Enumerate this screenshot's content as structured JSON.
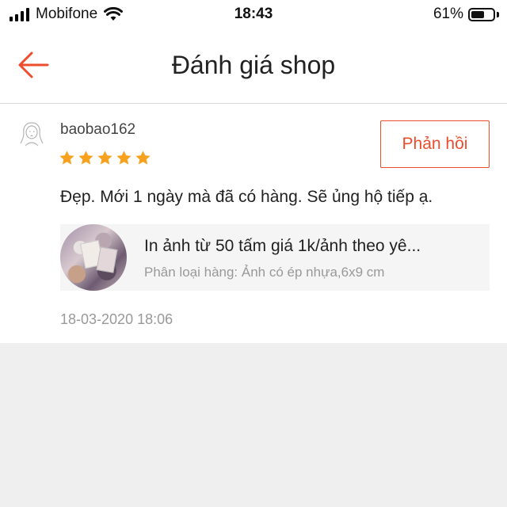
{
  "status_bar": {
    "carrier": "Mobifone",
    "time": "18:43",
    "battery_percent": "61%",
    "battery_level": 0.61
  },
  "nav": {
    "title": "Đánh giá shop"
  },
  "review": {
    "username": "baobao162",
    "rating": 5,
    "reply_label": "Phản hồi",
    "comment": "Đẹp. Mới 1 ngày mà đã có hàng. Sẽ ủng hộ tiếp ạ.",
    "product": {
      "name": "In ảnh từ 50 tấm giá 1k/ảnh theo yê...",
      "variation": "Phân loại hàng: Ảnh có ép nhựa,6x9 cm"
    },
    "timestamp": "18-03-2020 18:06"
  },
  "colors": {
    "accent": "#ee4d2d",
    "star": "#f8a11e"
  }
}
